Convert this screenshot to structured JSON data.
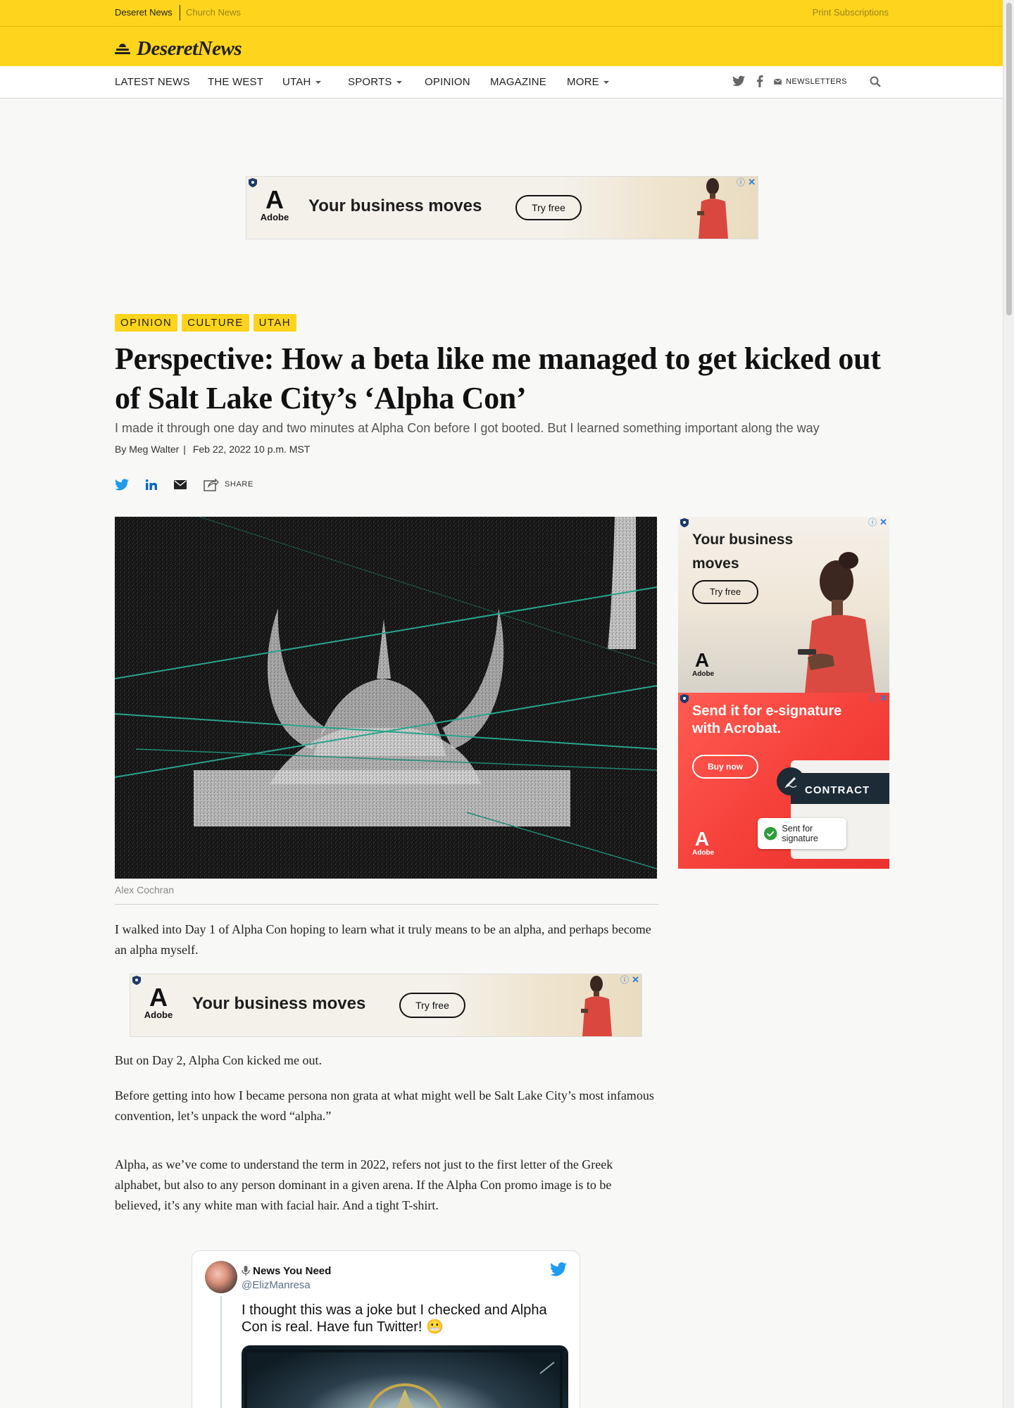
{
  "topbar": {
    "link_deseret": "Deseret News",
    "link_church": "Church News",
    "link_print": "Print Subscriptions"
  },
  "logo": {
    "text": "DeseretNews"
  },
  "nav": {
    "items": [
      {
        "label": "LATEST NEWS"
      },
      {
        "label": "THE WEST"
      },
      {
        "label": "UTAH"
      },
      {
        "label": "SPORTS"
      },
      {
        "label": "OPINION"
      },
      {
        "label": "MAGAZINE"
      },
      {
        "label": "MORE"
      }
    ],
    "newsletters": "NEWSLETTERS",
    "icons": [
      "twitter-icon",
      "facebook-icon",
      "mail-icon",
      "search-icon"
    ]
  },
  "ads": {
    "banner_headline": "Your business moves",
    "banner_cta": "Try free",
    "adobe_word": "Adobe",
    "side1_headline_1": "Your business",
    "side1_headline_2": "moves",
    "side1_cta": "Try free",
    "side2_headline_1": "Send it for e-signature",
    "side2_headline_2": "with Acrobat.",
    "side2_cta": "Buy now",
    "side2_contract": "CONTRACT",
    "side2_toast": "Sent for signature"
  },
  "article": {
    "tags": [
      "OPINION",
      "CULTURE",
      "UTAH"
    ],
    "title": "Perspective: How a beta like me managed to get kicked out of Salt Lake City’s ‘Alpha Con’",
    "dek": "I made it through one day and two minutes at Alpha Con before I got booted. But I learned something important along the way",
    "byline_prefix": "By",
    "author": "Meg Walter",
    "date": "Feb 22, 2022 10 p.m. MST",
    "share_label": "SHARE",
    "image_credit": "Alex Cochran",
    "paragraphs": [
      "I walked into Day 1 of Alpha Con hoping to learn what it truly means to be an alpha, and perhaps become an alpha myself.",
      "But on Day 2, Alpha Con kicked me out.",
      "Before getting into how I became persona non grata at what might well be Salt Lake City’s most infamous convention, let’s unpack the word “alpha.”",
      "Alpha, as we’ve come to understand the term in 2022, refers not just to the first letter of the Greek alphabet, but also to any person dominant in a given arena. If the Alpha Con promo image is to be believed, it’s any white man with facial hair. And a tight T-shirt."
    ]
  },
  "tweet": {
    "name": "News You Need",
    "handle": "@ElizManresa",
    "text": "I thought this was a joke but I checked and Alpha Con is real. Have fun Twitter! 😬"
  },
  "colors": {
    "brand_yellow": "#ffd41d",
    "twitter_blue": "#1d9bf0",
    "linkedin_blue": "#0a66c2"
  }
}
